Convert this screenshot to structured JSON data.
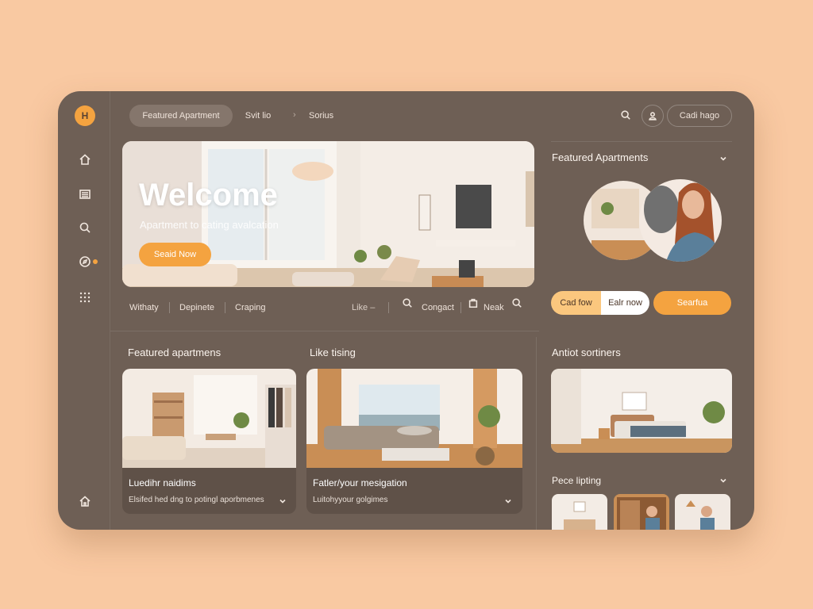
{
  "sidebar": {
    "logo_text": "H",
    "icons": [
      "home-icon",
      "list-icon",
      "search-icon",
      "compass-icon",
      "grid-icon"
    ],
    "bottom_icon": "home-icon"
  },
  "topbar": {
    "tabs": [
      {
        "label": "Featured Apartment",
        "active": true
      },
      {
        "label": "Svit lio",
        "active": false
      }
    ],
    "breadcrumb_sep": "›",
    "breadcrumb_item": "Sorius",
    "action_label": "Cadi hago"
  },
  "hero": {
    "title": "Welcome",
    "subtitle": "Apartment to cating avalcation",
    "button_label": "Seaid Now"
  },
  "filters": {
    "left": [
      "Withaty",
      "Depinete",
      "Craping"
    ],
    "select_label": "Like –",
    "contact_label": "Congact",
    "neak_label": "Neak"
  },
  "sections": {
    "featured_title": "Featured apartmens",
    "listing_title": "Like tising",
    "right_top_title": "Featured Apartments",
    "right_mid_title": "Antiot sortiners",
    "right_bottom_title": "Pece lipting"
  },
  "cards": [
    {
      "title": "Luedihr naidims",
      "desc": "Elsifed hed dng to potingl aporbmenes"
    },
    {
      "title": "Fatler/your mesigation",
      "desc": "Luitohyyour golgimes"
    }
  ],
  "right_panel": {
    "segment_a": "Cad fow",
    "segment_b": "Ealr now",
    "search_label": "Searfua"
  },
  "colors": {
    "accent": "#f4a340",
    "panel": "#6e5f55",
    "background": "#f9c9a2"
  }
}
